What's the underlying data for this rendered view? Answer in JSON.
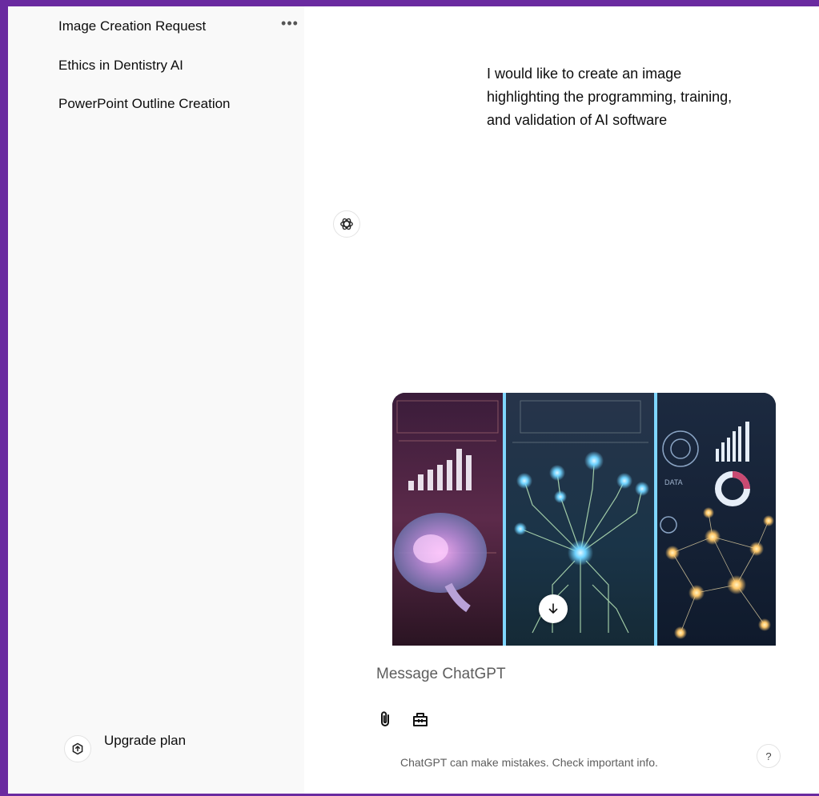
{
  "sidebar": {
    "items": [
      {
        "label": "Image Creation Request"
      },
      {
        "label": "Ethics in Dentistry AI"
      },
      {
        "label": "PowerPoint Outline Creation"
      }
    ],
    "more_icon": "ellipsis-icon",
    "upgrade": {
      "label": "Upgrade plan",
      "icon": "upgrade-icon"
    }
  },
  "chat": {
    "user_message": "I would like to create an image highlighting the programming, training, and validation of AI software",
    "assistant_avatar_icon": "openai-logo-icon",
    "generated_image": {
      "panels": [
        "brain-and-bar-chart",
        "circuit-tree",
        "network-and-dashboard"
      ],
      "overlay_text": "DATA",
      "download_icon": "arrow-down-icon"
    }
  },
  "composer": {
    "placeholder": "Message ChatGPT",
    "attach_icon": "paperclip-icon",
    "tools_icon": "toolbox-icon"
  },
  "footer": {
    "disclaimer": "ChatGPT can make mistakes. Check important info.",
    "help_label": "?"
  },
  "colors": {
    "frame_border": "#6a2aa0",
    "sidebar_bg": "#f9f9f9",
    "text": "#0d0d0d",
    "muted_text": "#5d5d5d"
  }
}
